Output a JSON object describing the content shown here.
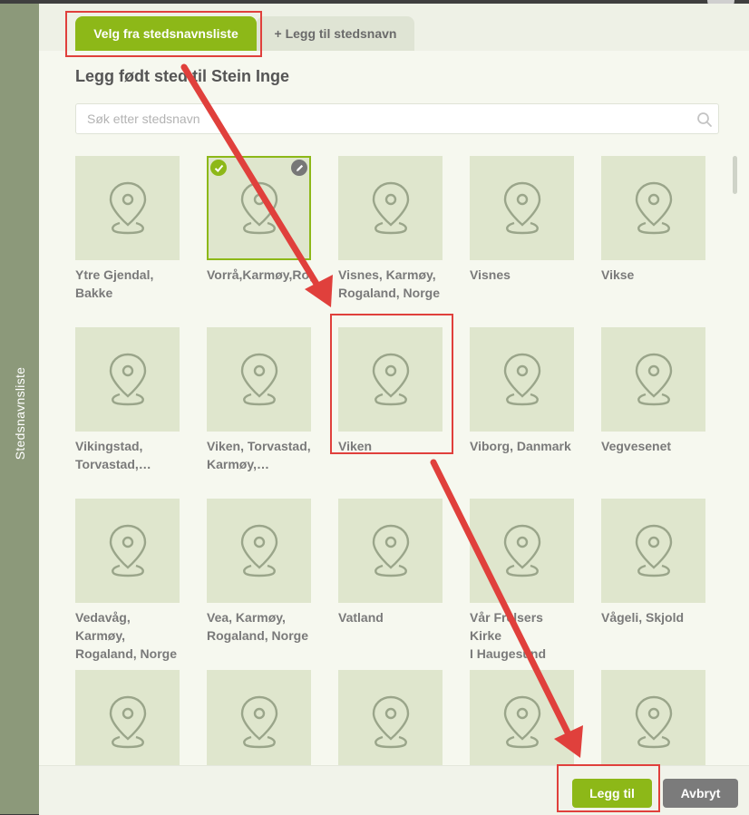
{
  "side_tab": {
    "label": "Stedsnavnsliste"
  },
  "tabs": [
    {
      "label": "Velg fra stedsnavnsliste",
      "active": true
    },
    {
      "label": "+ Legg til stedsnavn",
      "active": false
    }
  ],
  "heading": "Legg født sted til Stein Inge",
  "search": {
    "placeholder": "Søk etter stedsnavn",
    "value": ""
  },
  "places": [
    {
      "label": "Ytre Gjendal,\nBakke",
      "selected": false
    },
    {
      "label": "Vorrå,Karmøy,Rog",
      "selected": true
    },
    {
      "label": "Visnes, Karmøy,\nRogaland, Norge",
      "selected": false
    },
    {
      "label": "Visnes",
      "selected": false
    },
    {
      "label": "Vikse",
      "selected": false
    },
    {
      "label": "Vikingstad,\nTorvastad,…",
      "selected": false
    },
    {
      "label": "Viken, Torvastad,\nKarmøy,…",
      "selected": false
    },
    {
      "label": "Viken",
      "selected": false
    },
    {
      "label": "Viborg, Danmark",
      "selected": false
    },
    {
      "label": "Vegvesenet",
      "selected": false
    },
    {
      "label": "Vedavåg, Karmøy,\nRogaland, Norge",
      "selected": false
    },
    {
      "label": "Vea, Karmøy,\nRogaland, Norge",
      "selected": false
    },
    {
      "label": "Vatland",
      "selected": false
    },
    {
      "label": "Vår Frelsers Kirke\nI Haugesund",
      "selected": false
    },
    {
      "label": "Vågeli, Skjold",
      "selected": false
    },
    {
      "label": "",
      "selected": false
    },
    {
      "label": "",
      "selected": false
    },
    {
      "label": "",
      "selected": false
    },
    {
      "label": "",
      "selected": false
    },
    {
      "label": "",
      "selected": false
    }
  ],
  "buttons": {
    "add": "Legg til",
    "cancel": "Avbryt"
  },
  "colors": {
    "accent": "#8db818",
    "tile_bg": "#dfe6cd",
    "annotation": "#e0403c",
    "sidebar": "#8c997a"
  },
  "icons": {
    "place": "map-pin-icon",
    "search": "search-icon",
    "check": "check-icon",
    "edit": "pencil-icon"
  }
}
